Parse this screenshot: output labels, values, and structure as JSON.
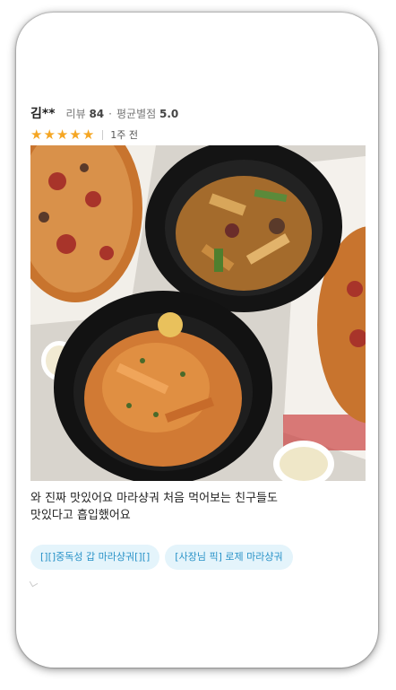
{
  "review": {
    "username": "김**",
    "review_label": "리뷰",
    "review_count": "84",
    "avg_label": "평균별점",
    "avg_rating": "5.0",
    "stars": 5,
    "posted_ago": "1주 전",
    "text": "와 진짜 맛있어요 마라샹궈 처음 먹어보는 친구들도\n맛있다고 흡입했어요",
    "tags": [
      "[][]중독성 갑 마라샹궈[][]",
      "[사장님 픽] 로제 마라샹궈"
    ]
  },
  "colors": {
    "star": "#f5a623",
    "tag_bg": "#e4f4fb",
    "tag_text": "#2a93c8"
  }
}
